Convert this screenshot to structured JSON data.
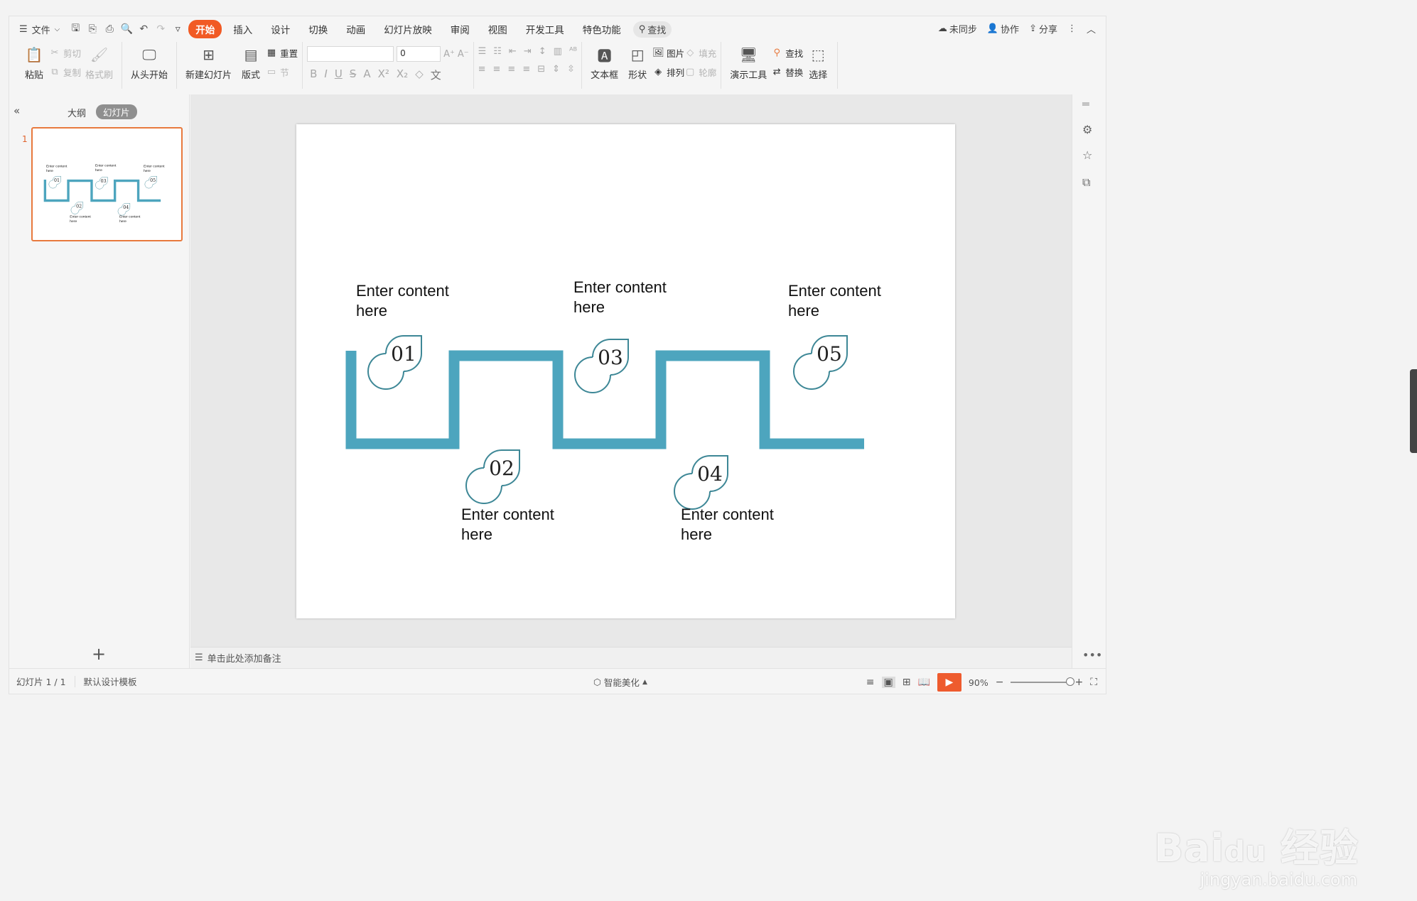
{
  "menubar": {
    "file_label": "文件",
    "tabs": [
      "开始",
      "插入",
      "设计",
      "切换",
      "动画",
      "幻灯片放映",
      "审阅",
      "视图",
      "开发工具",
      "特色功能"
    ],
    "search_label": "查找",
    "right": {
      "sync": "未同步",
      "collab": "协作",
      "share": "分享"
    }
  },
  "ribbon": {
    "paste": "粘贴",
    "cut": "剪切",
    "copy": "复制",
    "format_painter": "格式刷",
    "from_start": "从头开始",
    "new_slide": "新建幻灯片",
    "layout": "版式",
    "reset": "重置",
    "section": "节",
    "font_size_value": "0",
    "textbox": "文本框",
    "shape": "形状",
    "picture": "图片",
    "arrange": "排列",
    "fill": "填充",
    "outline": "轮廓",
    "present_tools": "演示工具",
    "find": "查找",
    "replace": "替换",
    "select": "选择"
  },
  "leftpanel": {
    "outline_tab": "大纲",
    "slides_tab": "幻灯片",
    "slide_number": "1",
    "add_icon": "+"
  },
  "slide": {
    "accent_color": "#4da5be",
    "items": [
      {
        "num": "01",
        "text_line1": "Enter content",
        "text_line2": "here"
      },
      {
        "num": "02",
        "text_line1": "Enter content",
        "text_line2": "here"
      },
      {
        "num": "03",
        "text_line1": "Enter content",
        "text_line2": "here"
      },
      {
        "num": "04",
        "text_line1": "Enter content",
        "text_line2": "here"
      },
      {
        "num": "05",
        "text_line1": "Enter content",
        "text_line2": "here"
      }
    ]
  },
  "notes": {
    "placeholder": "单击此处添加备注"
  },
  "statusbar": {
    "slide_indicator": "幻灯片 1 / 1",
    "template": "默认设计模板",
    "beautify": "智能美化",
    "zoom": "90%"
  },
  "watermark": {
    "brand": "Bai du 经验",
    "url": "jingyan.baidu.com"
  }
}
